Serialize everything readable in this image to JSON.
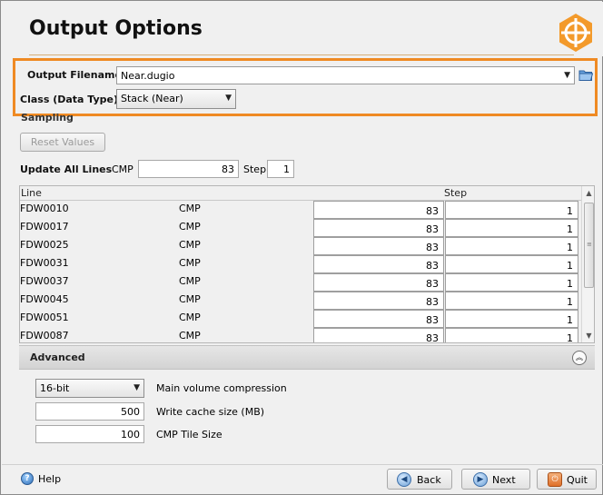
{
  "header": {
    "title": "Output Options"
  },
  "output": {
    "filename_label": "Output Filename",
    "filename_value": "Near.dugio",
    "class_label": "Class (Data Type)",
    "class_value": "Stack (Near)"
  },
  "sampling": {
    "section_label": "Sampling",
    "reset_label": "Reset Values",
    "update_all_label": "Update All Lines",
    "cmp_label": "CMP",
    "cmp_value": "83",
    "step_label": "Step",
    "step_value": "1"
  },
  "table": {
    "columns": [
      "Line",
      "",
      "",
      "Step"
    ],
    "rows": [
      {
        "line": "FDW0010",
        "type": "CMP",
        "cmp": "83",
        "step": "1"
      },
      {
        "line": "FDW0017",
        "type": "CMP",
        "cmp": "83",
        "step": "1"
      },
      {
        "line": "FDW0025",
        "type": "CMP",
        "cmp": "83",
        "step": "1"
      },
      {
        "line": "FDW0031",
        "type": "CMP",
        "cmp": "83",
        "step": "1"
      },
      {
        "line": "FDW0037",
        "type": "CMP",
        "cmp": "83",
        "step": "1"
      },
      {
        "line": "FDW0045",
        "type": "CMP",
        "cmp": "83",
        "step": "1"
      },
      {
        "line": "FDW0051",
        "type": "CMP",
        "cmp": "83",
        "step": "1"
      },
      {
        "line": "FDW0087",
        "type": "CMP",
        "cmp": "83",
        "step": "1"
      }
    ]
  },
  "advanced": {
    "title": "Advanced",
    "compression_value": "16-bit",
    "compression_label": "Main volume compression",
    "cache_value": "500",
    "cache_label": "Write cache size (MB)",
    "tile_value": "100",
    "tile_label": "CMP Tile Size"
  },
  "footer": {
    "help_label": "Help",
    "back_label": "Back",
    "next_label": "Next",
    "quit_label": "Quit"
  },
  "colors": {
    "highlight": "#ef8a23",
    "logo": "#f39a2b"
  },
  "icons": [
    "logo-crosshair-icon",
    "folder-icon",
    "chevron-down-icon",
    "collapse-icon",
    "help-icon",
    "back-icon",
    "next-icon",
    "quit-icon"
  ]
}
